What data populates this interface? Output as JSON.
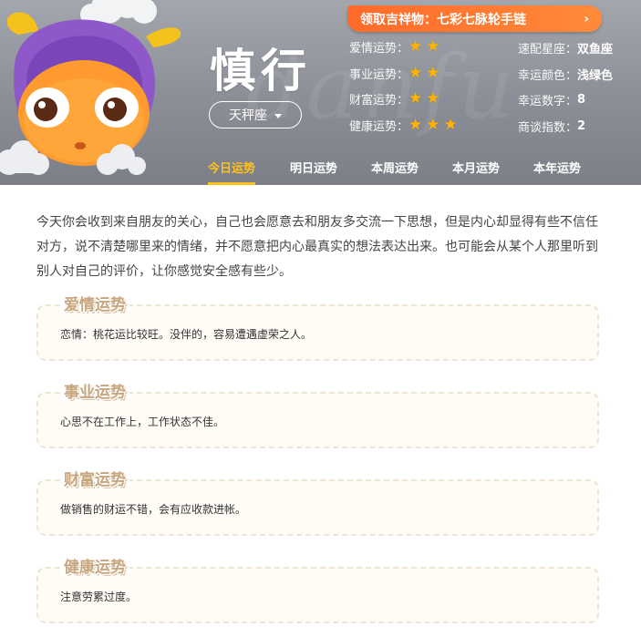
{
  "header": {
    "title": "慎行",
    "watermark": "danfu",
    "sign_select": {
      "value": "天秤座"
    },
    "banner": {
      "label": "领取吉祥物：七彩七脉轮手链",
      "arrow": "›"
    },
    "fortunes": [
      {
        "label": "爱情运势：",
        "stars": 2
      },
      {
        "label": "事业运势：",
        "stars": 2
      },
      {
        "label": "财富运势：",
        "stars": 2
      },
      {
        "label": "健康运势：",
        "stars": 3
      }
    ],
    "facts": [
      {
        "label": "速配星座：",
        "value": "双鱼座"
      },
      {
        "label": "幸运颜色：",
        "value": "浅绿色"
      },
      {
        "label": "幸运数字：",
        "value": "8"
      },
      {
        "label": "商谈指数：",
        "value": "2"
      }
    ],
    "tabs": [
      {
        "label": "今日运势",
        "active": true
      },
      {
        "label": "明日运势",
        "active": false
      },
      {
        "label": "本周运势",
        "active": false
      },
      {
        "label": "本月运势",
        "active": false
      },
      {
        "label": "本年运势",
        "active": false
      }
    ]
  },
  "intro": "今天你会收到来自朋友的关心，自己也会愿意去和朋友多交流一下思想，但是内心却显得有些不信任对方，说不清楚哪里来的情绪，并不愿意把内心最真实的想法表达出来。也可能会从某个人那里听到别人对自己的评价，让你感觉安全感有些少。",
  "sections": [
    {
      "title": "爱情运势",
      "text": "恋情：桃花运比较旺。没伴的，容易遭遇虚荣之人。"
    },
    {
      "title": "事业运势",
      "text": "心思不在工作上，工作状态不佳。"
    },
    {
      "title": "财富运势",
      "text": "做销售的财运不错，会有应收款进帐。"
    },
    {
      "title": "健康运势",
      "text": "注意劳累过度。"
    }
  ],
  "colors": {
    "accent": "#ffc01a",
    "banner": "#ff6a2a",
    "star": "#ffb400",
    "header_bg": "#8b8e96"
  }
}
